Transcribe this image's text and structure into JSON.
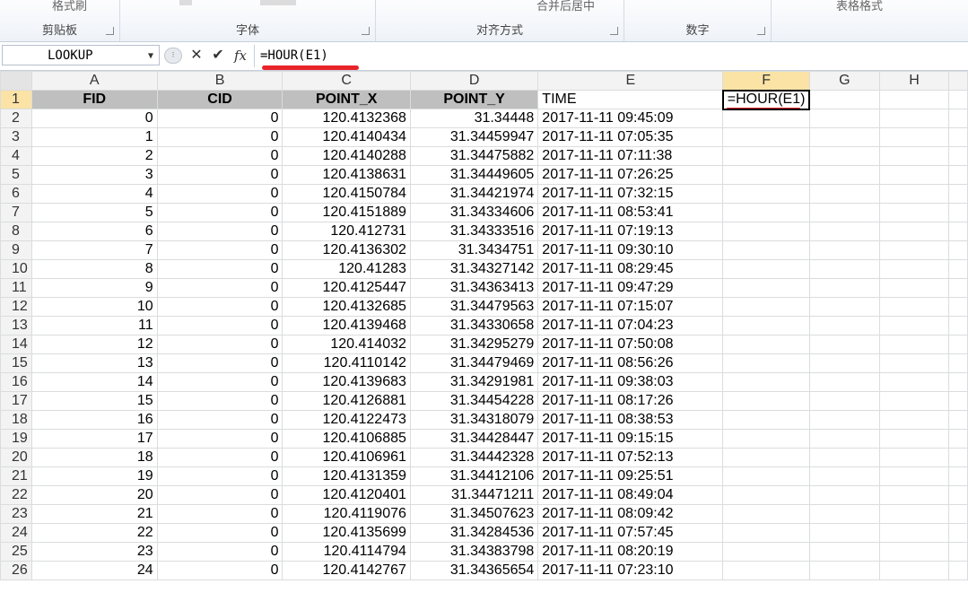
{
  "ribbon": {
    "groups": [
      {
        "label": "剪贴板"
      },
      {
        "label": "字体"
      },
      {
        "label": "对齐方式"
      },
      {
        "label": "数字"
      }
    ],
    "clipped": {
      "format_painter": "格式刷",
      "merge_center": "合并后居中",
      "table_format": "表格格式"
    }
  },
  "formula_bar": {
    "name_box": "LOOKUP",
    "formula": "=HOUR(E1)"
  },
  "columns": [
    "A",
    "B",
    "C",
    "D",
    "E",
    "F",
    "G",
    "H"
  ],
  "header_row": {
    "row": "1",
    "cells": [
      "FID",
      "CID",
      "POINT_X",
      "POINT_Y",
      "TIME",
      "=HOUR(E1)",
      "",
      ""
    ]
  },
  "rows": [
    {
      "row": "2",
      "cells": [
        "0",
        "0",
        "120.4132368",
        "31.34448",
        "2017-11-11 09:45:09"
      ]
    },
    {
      "row": "3",
      "cells": [
        "1",
        "0",
        "120.4140434",
        "31.34459947",
        "2017-11-11 07:05:35"
      ]
    },
    {
      "row": "4",
      "cells": [
        "2",
        "0",
        "120.4140288",
        "31.34475882",
        "2017-11-11 07:11:38"
      ]
    },
    {
      "row": "5",
      "cells": [
        "3",
        "0",
        "120.4138631",
        "31.34449605",
        "2017-11-11 07:26:25"
      ]
    },
    {
      "row": "6",
      "cells": [
        "4",
        "0",
        "120.4150784",
        "31.34421974",
        "2017-11-11 07:32:15"
      ]
    },
    {
      "row": "7",
      "cells": [
        "5",
        "0",
        "120.4151889",
        "31.34334606",
        "2017-11-11 08:53:41"
      ]
    },
    {
      "row": "8",
      "cells": [
        "6",
        "0",
        "120.412731",
        "31.34333516",
        "2017-11-11 07:19:13"
      ]
    },
    {
      "row": "9",
      "cells": [
        "7",
        "0",
        "120.4136302",
        "31.3434751",
        "2017-11-11 09:30:10"
      ]
    },
    {
      "row": "10",
      "cells": [
        "8",
        "0",
        "120.41283",
        "31.34327142",
        "2017-11-11 08:29:45"
      ]
    },
    {
      "row": "11",
      "cells": [
        "9",
        "0",
        "120.4125447",
        "31.34363413",
        "2017-11-11 09:47:29"
      ]
    },
    {
      "row": "12",
      "cells": [
        "10",
        "0",
        "120.4132685",
        "31.34479563",
        "2017-11-11 07:15:07"
      ]
    },
    {
      "row": "13",
      "cells": [
        "11",
        "0",
        "120.4139468",
        "31.34330658",
        "2017-11-11 07:04:23"
      ]
    },
    {
      "row": "14",
      "cells": [
        "12",
        "0",
        "120.414032",
        "31.34295279",
        "2017-11-11 07:50:08"
      ]
    },
    {
      "row": "15",
      "cells": [
        "13",
        "0",
        "120.4110142",
        "31.34479469",
        "2017-11-11 08:56:26"
      ]
    },
    {
      "row": "16",
      "cells": [
        "14",
        "0",
        "120.4139683",
        "31.34291981",
        "2017-11-11 09:38:03"
      ]
    },
    {
      "row": "17",
      "cells": [
        "15",
        "0",
        "120.4126881",
        "31.34454228",
        "2017-11-11 08:17:26"
      ]
    },
    {
      "row": "18",
      "cells": [
        "16",
        "0",
        "120.4122473",
        "31.34318079",
        "2017-11-11 08:38:53"
      ]
    },
    {
      "row": "19",
      "cells": [
        "17",
        "0",
        "120.4106885",
        "31.34428447",
        "2017-11-11 09:15:15"
      ]
    },
    {
      "row": "20",
      "cells": [
        "18",
        "0",
        "120.4106961",
        "31.34442328",
        "2017-11-11 07:52:13"
      ]
    },
    {
      "row": "21",
      "cells": [
        "19",
        "0",
        "120.4131359",
        "31.34412106",
        "2017-11-11 09:25:51"
      ]
    },
    {
      "row": "22",
      "cells": [
        "20",
        "0",
        "120.4120401",
        "31.34471211",
        "2017-11-11 08:49:04"
      ]
    },
    {
      "row": "23",
      "cells": [
        "21",
        "0",
        "120.4119076",
        "31.34507623",
        "2017-11-11 08:09:42"
      ]
    },
    {
      "row": "24",
      "cells": [
        "22",
        "0",
        "120.4135699",
        "31.34284536",
        "2017-11-11 07:57:45"
      ]
    },
    {
      "row": "25",
      "cells": [
        "23",
        "0",
        "120.4114794",
        "31.34383798",
        "2017-11-11 08:20:19"
      ]
    },
    {
      "row": "26",
      "cells": [
        "24",
        "0",
        "120.4142767",
        "31.34365654",
        "2017-11-11 07:23:10"
      ]
    }
  ],
  "colors": {
    "header_fill": "#bfbfbf",
    "annotation_red": "#e8232a",
    "selected_header": "#fbe3a6"
  },
  "icons": {
    "name_box_dropdown": "chevron-down-icon",
    "cancel": "close-icon",
    "enter": "check-icon",
    "insert_function": "fx-icon"
  }
}
